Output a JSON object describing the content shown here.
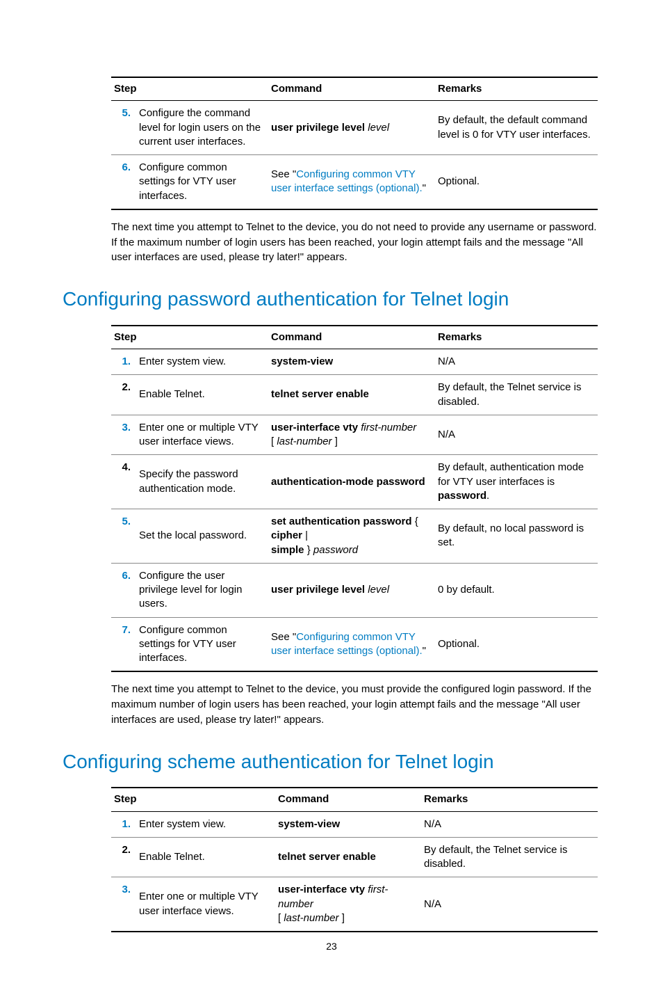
{
  "page_number": "23",
  "table1": {
    "headers": {
      "step": "Step",
      "command": "Command",
      "remarks": "Remarks"
    },
    "rows": [
      {
        "num": "5.",
        "step": "Configure the command level for login users on the current user interfaces.",
        "cmd_bold": "user privilege level",
        "cmd_italic": " level",
        "remarks": "By default, the default command level is 0 for VTY user interfaces."
      },
      {
        "num": "6.",
        "step": "Configure common settings for VTY user interfaces.",
        "remarks_prefix": "See \"",
        "remarks_link": "Configuring common VTY user interface settings (optional).",
        "remarks_suffix": "\"",
        "remarks": "Optional."
      }
    ]
  },
  "para1": "The next time you attempt to Telnet to the device, you do not need to provide any username or password. If the maximum number of login users has been reached, your login attempt fails and the message \"All user interfaces are used, please try later!\" appears.",
  "heading1": "Configuring password authentication for Telnet login",
  "table2": {
    "headers": {
      "step": "Step",
      "command": "Command",
      "remarks": "Remarks"
    },
    "rows": [
      {
        "num": "1.",
        "step": "Enter system view.",
        "cmd_bold": "system-view",
        "remarks": "N/A"
      },
      {
        "num": "2.",
        "step": "Enable Telnet.",
        "cmd_bold": "telnet server enable",
        "remarks": "By default, the Telnet service is disabled."
      },
      {
        "num": "3.",
        "step": "Enter one or multiple VTY user interface views.",
        "cmd_bold": "user-interface vty",
        "cmd_italic": " first-number",
        "cmd_line2_plain": "[ ",
        "cmd_line2_italic": "last-number",
        "cmd_line2_plain2": " ]",
        "remarks": "N/A"
      },
      {
        "num": "4.",
        "step": "Specify the password authentication mode.",
        "cmd_bold": "authentication-mode password",
        "remarks_html": "By default, authentication mode for VTY user interfaces is ",
        "remarks_bold": "password",
        "remarks_tail": "."
      },
      {
        "num": "5.",
        "step": "Set the local password.",
        "cmd_bold": "set authentication password",
        "cmd_plain": " { ",
        "cmd_bold2": "cipher",
        "cmd_plain2": " | ",
        "cmd_bold3": "simple",
        "cmd_plain3": " } ",
        "cmd_italic2": "password",
        "remarks": "By default, no local password is set."
      },
      {
        "num": "6.",
        "step": "Configure the user privilege level for login users.",
        "cmd_bold": "user privilege level",
        "cmd_italic": " level",
        "remarks": "0 by default."
      },
      {
        "num": "7.",
        "step": "Configure common settings for VTY user interfaces.",
        "remarks_prefix": "See \"",
        "remarks_link": "Configuring common VTY user interface settings (optional).",
        "remarks_suffix": "\"",
        "remarks": "Optional."
      }
    ]
  },
  "para2": "The next time you attempt to Telnet to the device, you must provide the configured login password. If the maximum number of login users has been reached, your login attempt fails and the message \"All user interfaces are used, please try later!\" appears.",
  "heading2": "Configuring scheme authentication for Telnet login",
  "table3": {
    "headers": {
      "step": "Step",
      "command": "Command",
      "remarks": "Remarks"
    },
    "rows": [
      {
        "num": "1.",
        "step": "Enter system view.",
        "cmd_bold": "system-view",
        "remarks": "N/A"
      },
      {
        "num": "2.",
        "step": "Enable Telnet.",
        "cmd_bold": "telnet server enable",
        "remarks": "By default, the Telnet service is disabled."
      },
      {
        "num": "3.",
        "step": "Enter one or multiple VTY user interface views.",
        "cmd_bold": "user-interface vty",
        "cmd_italic": " first-number",
        "cmd_line2_plain": "[ ",
        "cmd_line2_italic": "last-number",
        "cmd_line2_plain2": " ]",
        "remarks": "N/A"
      }
    ]
  }
}
